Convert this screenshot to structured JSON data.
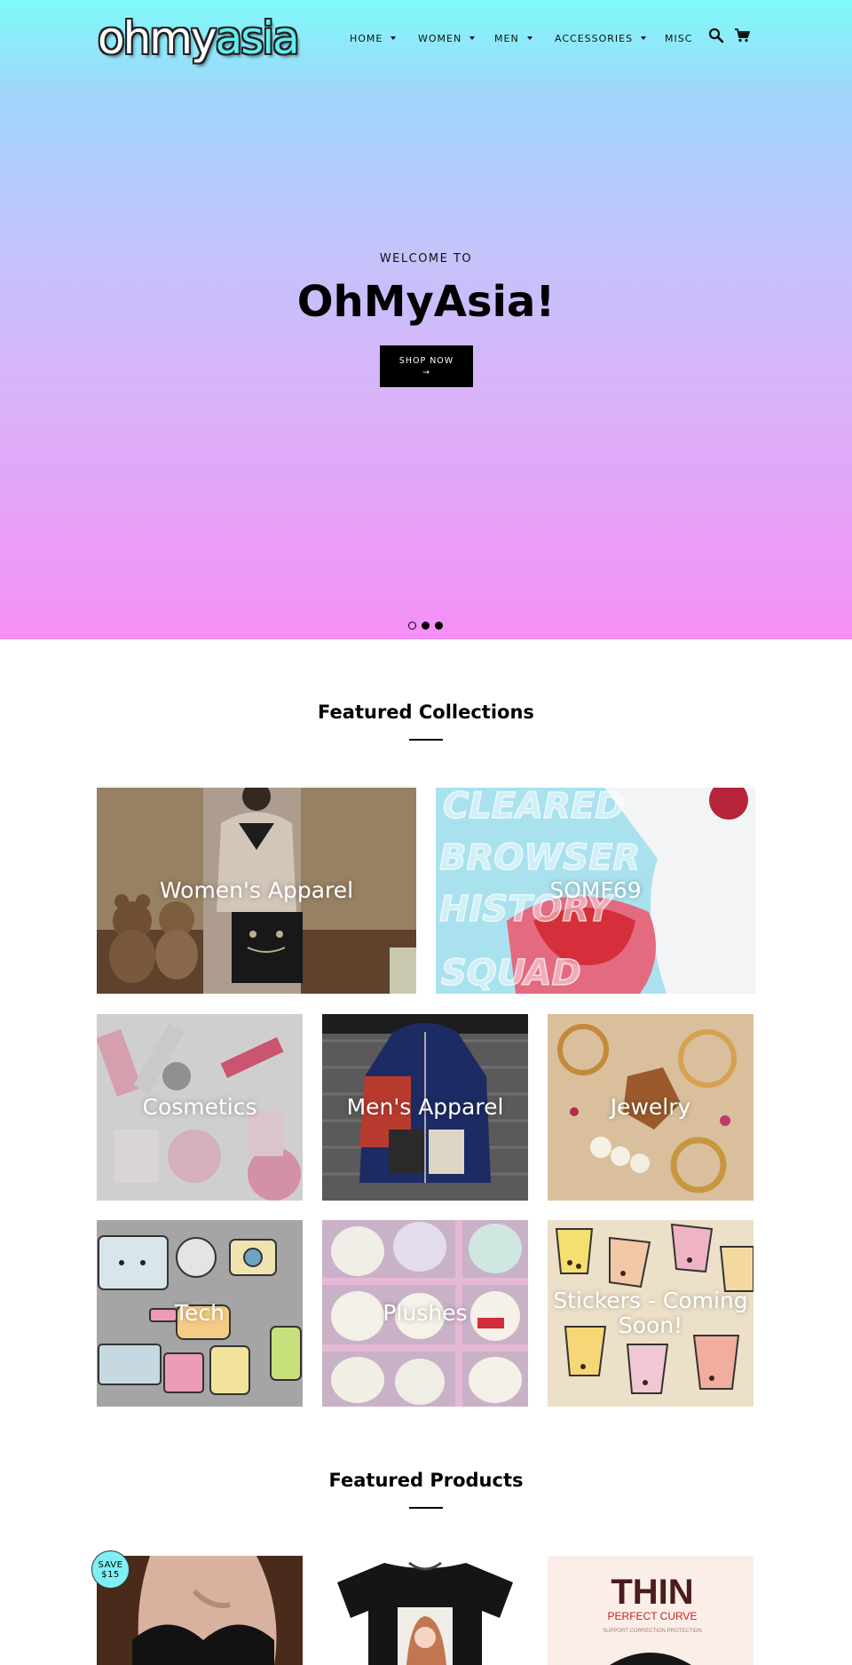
{
  "header": {
    "logo_part1": "ohmy",
    "logo_part2": "asia",
    "nav": [
      {
        "label": "HOME",
        "dropdown": true
      },
      {
        "label": "WOMEN",
        "dropdown": true
      },
      {
        "label": "MEN",
        "dropdown": true
      },
      {
        "label": "ACCESSORIES",
        "dropdown": true
      },
      {
        "label": "MISC",
        "dropdown": false
      }
    ],
    "icons": [
      "search-icon",
      "cart-icon"
    ]
  },
  "hero": {
    "subtitle": "WELCOME TO",
    "title": "OhMyAsia!",
    "button_label": "SHOP NOW",
    "button_arrow": "→",
    "slides": 3,
    "active_slide": 1
  },
  "featured_collections": {
    "title": "Featured Collections",
    "items": [
      {
        "label": "Women's Apparel"
      },
      {
        "label": "SOMF69",
        "image_text": [
          "CLEARED",
          "BROWSER",
          "HISTORY",
          "SQUAD"
        ]
      },
      {
        "label": "Cosmetics"
      },
      {
        "label": "Men's Apparel"
      },
      {
        "label": "Jewelry"
      },
      {
        "label": "Tech"
      },
      {
        "label": "Plushes"
      },
      {
        "label": "Stickers - Coming Soon!"
      }
    ]
  },
  "featured_products": {
    "title": "Featured Products",
    "save_badge": [
      "SAVE",
      "$15"
    ],
    "product3_image_text": [
      "THIN",
      "PERFECT CURVE",
      "SUPPORT CORRECTION PROTECTION"
    ]
  },
  "colors": {
    "hero_top": "#7ffaf9",
    "hero_bottom": "#f58ff6",
    "badge": "#7ef0f4",
    "text": "#000000"
  }
}
